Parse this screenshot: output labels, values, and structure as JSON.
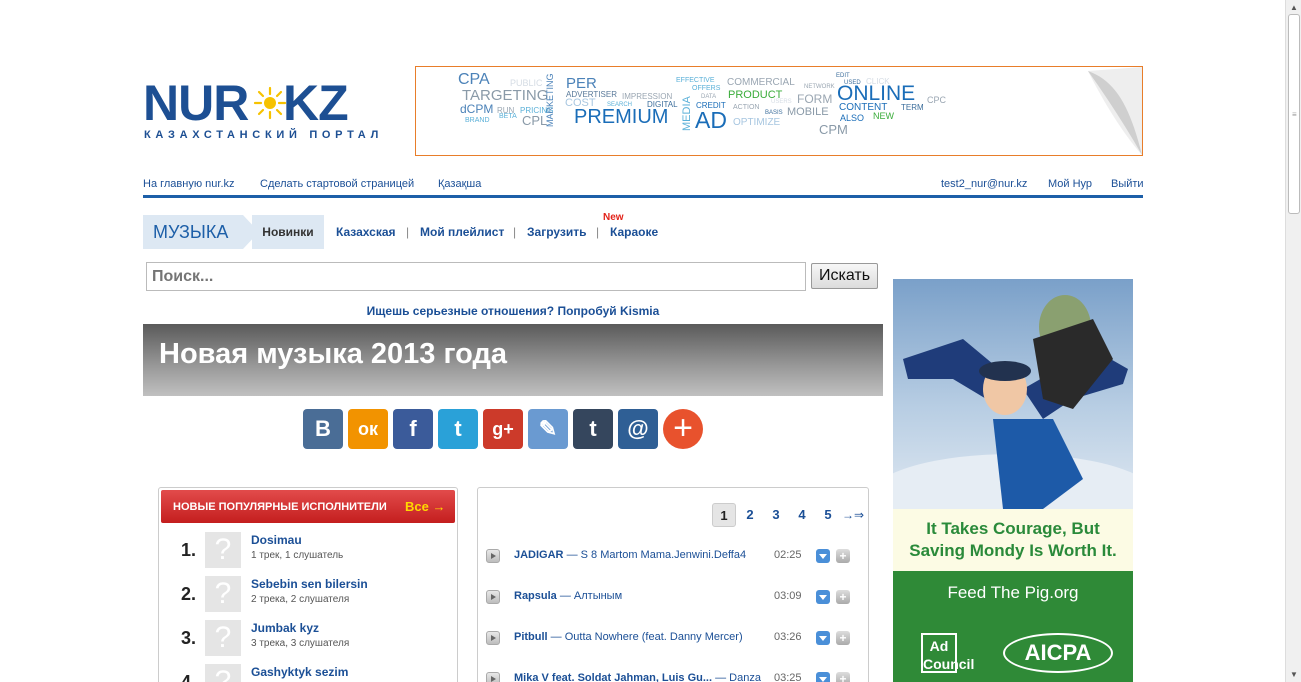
{
  "logo": {
    "left": "NUR",
    "right": "KZ",
    "tagline": "КАЗАХСТАНСКИЙ ПОРТАЛ"
  },
  "banner": {
    "words": [
      "CPA",
      "PUBLIC",
      "PER",
      "TARGETING",
      "ADVERTISER",
      "IMPRESSION",
      "dCPM",
      "COST",
      "SEARCH",
      "DIGITAL",
      "RUN",
      "PRICING",
      "CPL",
      "BRAND",
      "BETA",
      "MARKETING",
      "PREMIUM",
      "MEDIA",
      "EFFECTIVE",
      "OFFERS",
      "COMMERCIAL",
      "DATA",
      "PRODUCT",
      "CREDIT",
      "ACTION",
      "BASIS",
      "AD",
      "OPTIMIZE",
      "USERS",
      "FORM",
      "MOBILE",
      "NETWORK",
      "EDIT",
      "USED",
      "CLICK",
      "ONLINE",
      "CONTENT",
      "ALSO",
      "NEW",
      "TERM",
      "CPC",
      "CPM"
    ],
    "accent": "#e87d2a"
  },
  "toplinks": {
    "home": "На главную nur.kz",
    "start": "Сделать стартовой страницей",
    "kz": "Қазақша",
    "email": "test2_nur@nur.kz",
    "my": "Мой Нур",
    "logout": "Выйти"
  },
  "musicnav": {
    "section": "МУЗЫКА",
    "items": [
      "Новинки",
      "Казахская",
      "Мой плейлист",
      "Загрузить",
      "Караоке"
    ],
    "new_badge": "New"
  },
  "search": {
    "placeholder": "Поиск...",
    "button": "Искать"
  },
  "promo": "Ищешь серьезные отношения? Попробуй Kismia",
  "hero": {
    "title": "Новая музыка 2013 года"
  },
  "share": [
    {
      "icon": "vk-icon",
      "glyph": "В",
      "color": "#4a6d96"
    },
    {
      "icon": "odnoklassniki-icon",
      "glyph": "ок",
      "color": "#f29300"
    },
    {
      "icon": "facebook-icon",
      "glyph": "f",
      "color": "#3b5b9a"
    },
    {
      "icon": "twitter-icon",
      "glyph": "t",
      "color": "#2aa1d8"
    },
    {
      "icon": "googleplus-icon",
      "glyph": "g+",
      "color": "#cc3a2a"
    },
    {
      "icon": "livejournal-icon",
      "glyph": "✎",
      "color": "#6a9ad1"
    },
    {
      "icon": "tumblr-icon",
      "glyph": "t",
      "color": "#35465d"
    },
    {
      "icon": "mailru-icon",
      "glyph": "@",
      "color": "#2f5f95"
    },
    {
      "icon": "plus-icon",
      "glyph": "+",
      "color": "#e8522d"
    }
  ],
  "artists_panel": {
    "title": "НОВЫЕ ПОПУЛЯРНЫЕ ИСПОЛНИТЕЛИ",
    "all": "Все →",
    "items": [
      {
        "num": "1.",
        "name": "Dosimau",
        "meta": "1 трек, 1 слушатель"
      },
      {
        "num": "2.",
        "name": "Sebebin sen bilersin",
        "meta": "2 трека, 2 слушателя"
      },
      {
        "num": "3.",
        "name": "Jumbak kyz",
        "meta": "3 трека, 3 слушателя"
      },
      {
        "num": "4.",
        "name": "Gashyktyk sezim",
        "meta": ""
      }
    ]
  },
  "tracks_panel": {
    "pages": [
      "1",
      "2",
      "3",
      "4",
      "5"
    ],
    "next": "→⇒",
    "tracks": [
      {
        "artist": "JADIGAR",
        "title": " — S 8 Martom Mama.Jenwini.Deffa4",
        "duration": "02:25"
      },
      {
        "artist": "Rapsula",
        "title": " — Алтыным",
        "duration": "03:09"
      },
      {
        "artist": "Pitbull",
        "title": " — Outta Nowhere (feat. Danny Mercer)",
        "duration": "03:26"
      },
      {
        "artist": "Mika V feat. Soldat Jahman, Luis Gu...",
        "title": " — Danza",
        "duration": "03:25"
      }
    ]
  },
  "side_ad": {
    "line1": "It Takes Courage, But",
    "line2": "Saving Mondy Is Worth It.",
    "feed": "Feed The Pig.org",
    "adcouncil": "Ad Council",
    "aicpa": "AICPA"
  }
}
